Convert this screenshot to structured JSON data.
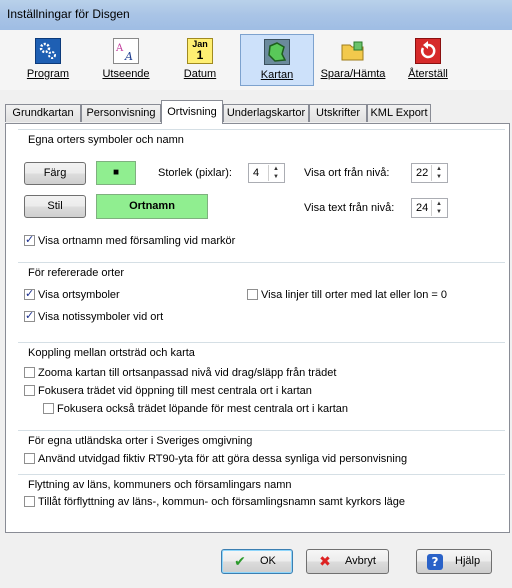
{
  "window": {
    "title": "Inställningar för Disgen"
  },
  "toolbar": {
    "items": [
      {
        "label": "Program",
        "icon": "gears-icon"
      },
      {
        "label": "Utseende",
        "icon": "fonts-icon"
      },
      {
        "label": "Datum",
        "icon": "calendar-icon"
      },
      {
        "label": "Kartan",
        "icon": "map-icon",
        "selected": true
      },
      {
        "label": "Spara/Hämta",
        "icon": "folder-save-icon"
      },
      {
        "label": "Återställ",
        "icon": "reset-icon"
      }
    ],
    "calendar_top": "Jan",
    "calendar_day": "1"
  },
  "tabs": [
    "Grundkartan",
    "Personvisning",
    "Ortvisning",
    "Underlagskartor",
    "Utskrifter",
    "KML Export"
  ],
  "active_tab": "Ortvisning",
  "groups": {
    "egna": {
      "title": "Egna orters symboler och namn",
      "farg_button": "Färg",
      "farg_swatch": "■",
      "stil_button": "Stil",
      "stil_swatch": "Ortnamn",
      "storlek_label": "Storlek (pixlar):",
      "storlek_value": "4",
      "visa_ort_label": "Visa ort från nivå:",
      "visa_ort_value": "22",
      "visa_text_label": "Visa text från nivå:",
      "visa_text_value": "24",
      "cb_forsamling": "Visa ortnamn med församling vid markör",
      "swatch_color": "#90ee90"
    },
    "refererade": {
      "title": "För refererade orter",
      "cb_ortsymboler": "Visa ortsymboler",
      "cb_linjer": "Visa linjer till orter med lat eller lon = 0",
      "cb_notissymboler": "Visa notissymboler vid ort"
    },
    "koppling": {
      "title": "Koppling mellan ortsträd och karta",
      "cb_zooma": "Zooma kartan till ortsanpassad nivå vid drag/släpp från trädet",
      "cb_fokusera": "Fokusera trädet vid öppning till mest centrala ort i kartan",
      "cb_fokusera_lopande": "Fokusera också trädet löpande för mest centrala ort i kartan"
    },
    "utlandska": {
      "title": "För egna utländska orter i Sveriges omgivning",
      "cb_rt90": "Använd utvidgad fiktiv RT90-yta för att göra dessa synliga vid personvisning"
    },
    "flyttning": {
      "title": "Flyttning av läns, kommuners och församlingars namn",
      "cb_tillat": "Tillåt förflyttning av  läns-, kommun- och församlingsnamn samt kyrkors läge"
    }
  },
  "buttons": {
    "ok": "OK",
    "avbryt": "Avbryt",
    "hjalp": "Hjälp"
  }
}
